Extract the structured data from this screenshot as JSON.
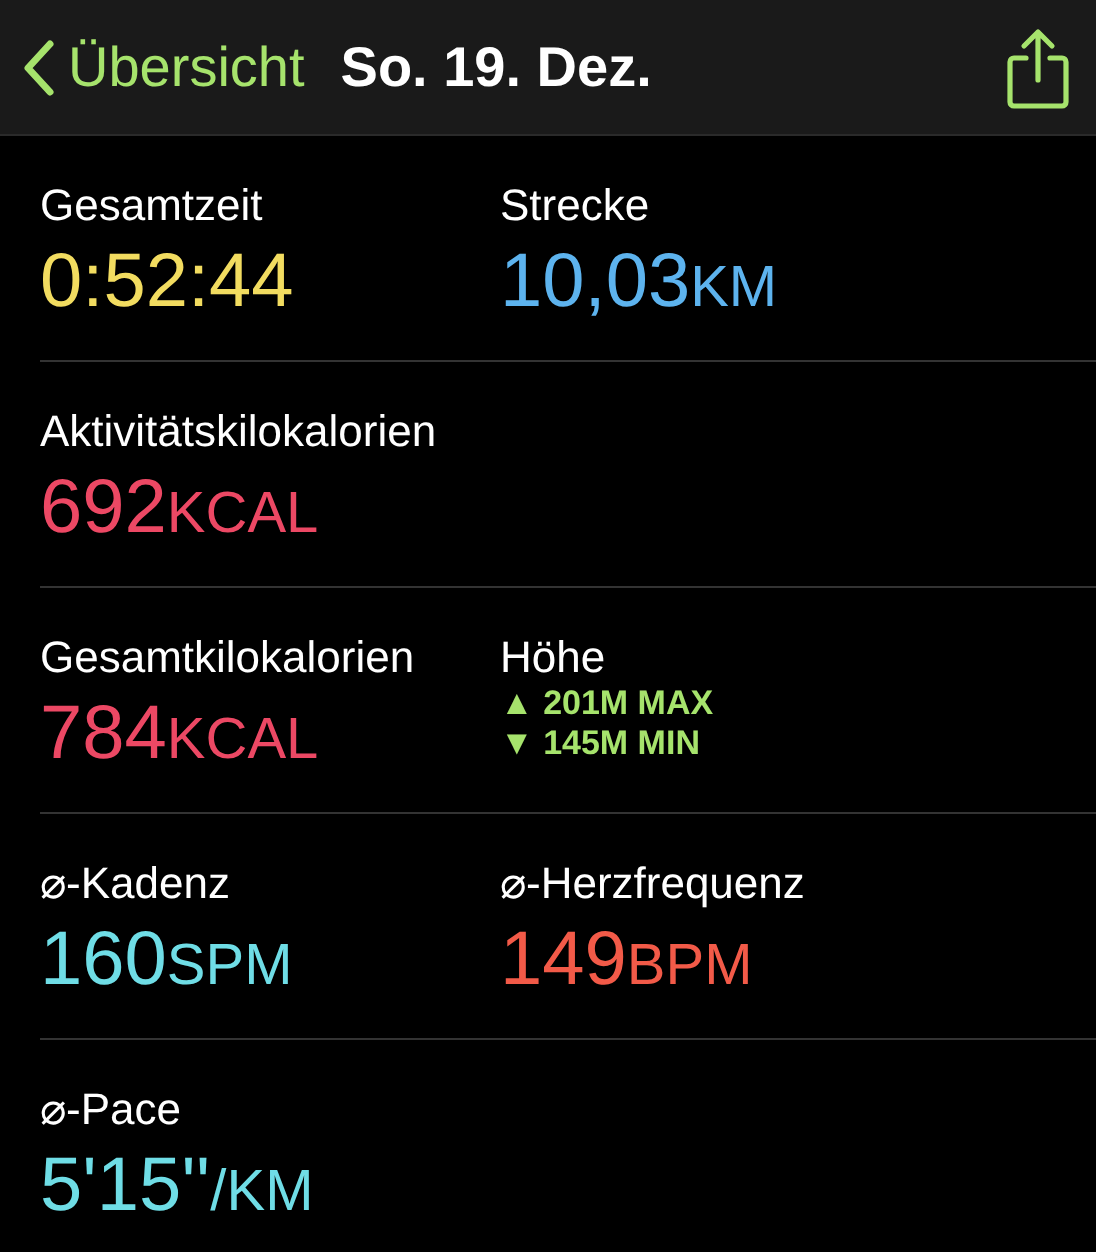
{
  "nav": {
    "back_label": "Übersicht",
    "title": "So. 19. Dez."
  },
  "rows": [
    {
      "cells": [
        {
          "kind": "metric",
          "label": "Gesamtzeit",
          "value": "0:52:44",
          "color": "#f2dc60"
        },
        {
          "kind": "metric",
          "label": "Strecke",
          "value": "10,03",
          "unit": "KM",
          "color": "#5db3ee"
        }
      ]
    },
    {
      "cells": [
        {
          "kind": "metric",
          "label": "Aktivitätskilokalorien",
          "value": "692",
          "unit": "KCAL",
          "color": "#ec4864"
        }
      ]
    },
    {
      "cells": [
        {
          "kind": "metric",
          "label": "Gesamtkilokalorien",
          "value": "784",
          "unit": "KCAL",
          "color": "#ec4864"
        },
        {
          "kind": "elevation",
          "label": "Höhe",
          "lines": [
            {
              "arrow": "▲",
              "text": "201M MAX"
            },
            {
              "arrow": "▼",
              "text": "145M MIN"
            }
          ],
          "color": "#a6e36c"
        }
      ]
    },
    {
      "cells": [
        {
          "kind": "metric",
          "label": "⌀-Kadenz",
          "value": "160",
          "unit": "SPM",
          "color": "#6fdde6"
        },
        {
          "kind": "metric",
          "label": "⌀-Herzfrequenz",
          "value": "149",
          "unit": "BPM",
          "color": "#f25a48"
        }
      ]
    },
    {
      "cells": [
        {
          "kind": "metric",
          "label": "⌀-Pace",
          "value": "5'15''",
          "unit": "/KM",
          "color": "#6fdde6"
        }
      ]
    }
  ]
}
